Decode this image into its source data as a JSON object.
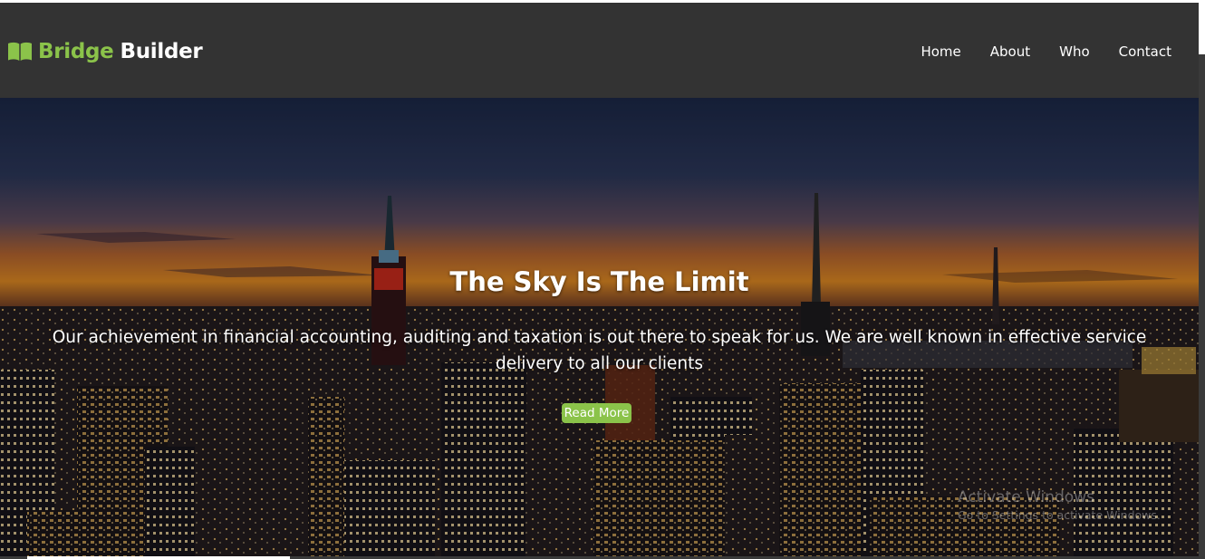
{
  "brand": {
    "name_first": "Bridge",
    "name_second": "Builder",
    "icon": "open-book-icon",
    "accent_color": "#8bc34a"
  },
  "nav": {
    "items": [
      {
        "label": "Home"
      },
      {
        "label": "About"
      },
      {
        "label": "Who"
      },
      {
        "label": "Contact"
      }
    ]
  },
  "hero": {
    "title": "The Sky Is The Limit",
    "text": "Our achievement in financial accounting, auditing and taxation is out there to speak for us. We are well known in effective service delivery to all our clients",
    "button_label": "Read More"
  },
  "watermark": {
    "line1": "Activate Windows",
    "line2": "Go to Settings to activate Windows."
  },
  "colors": {
    "navbar_bg": "#333333",
    "button_bg": "#8bc34a"
  }
}
